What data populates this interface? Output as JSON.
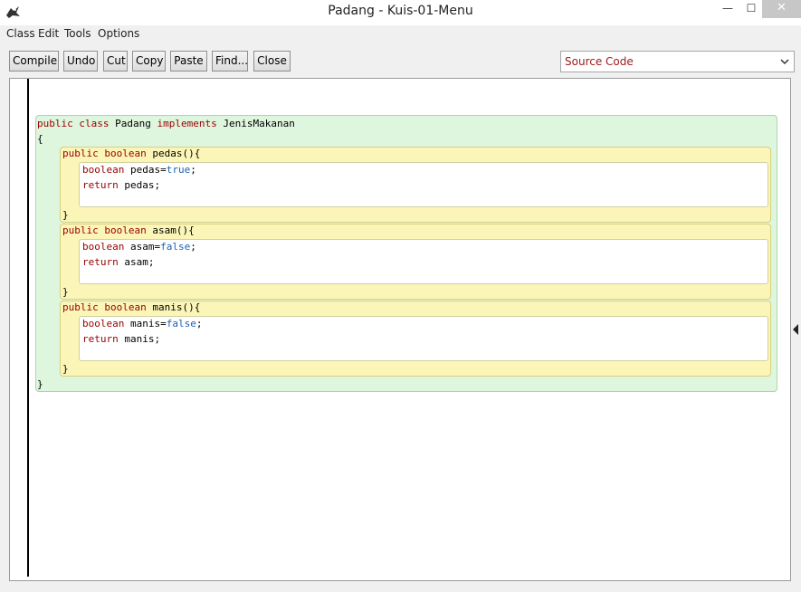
{
  "window": {
    "title": "Padang - Kuis-01-Menu",
    "min_glyph": "—",
    "max_glyph": "☐",
    "close_glyph": "✕"
  },
  "menu": [
    "Class",
    "Edit",
    "Tools",
    "Options"
  ],
  "toolbar": {
    "buttons": [
      "Compile",
      "Undo",
      "Cut",
      "Copy",
      "Paste",
      "Find...",
      "Close"
    ],
    "view_select": "Source Code"
  },
  "code": {
    "class_decl": {
      "kw1": "public",
      "kw2": "class",
      "name": "Padang",
      "kw3": "implements",
      "iface": "JenisMakanan"
    },
    "open_brace": "{",
    "close_brace": "}",
    "methods": [
      {
        "sig_kw1": "public",
        "sig_kw2": "boolean",
        "sig_name": "pedas(){",
        "line1_kw": "boolean",
        "line1_var": "pedas=",
        "line1_val": "true",
        "line1_end": ";",
        "line2_kw": "return",
        "line2_rest": "pedas;",
        "close": "}"
      },
      {
        "sig_kw1": "public",
        "sig_kw2": "boolean",
        "sig_name": "asam(){",
        "line1_kw": "boolean",
        "line1_var": "asam=",
        "line1_val": "false",
        "line1_end": ";",
        "line2_kw": "return",
        "line2_rest": "asam;",
        "close": "}"
      },
      {
        "sig_kw1": "public",
        "sig_kw2": "boolean",
        "sig_name": "manis(){",
        "line1_kw": "boolean",
        "line1_var": "manis=",
        "line1_val": "false",
        "line1_end": ";",
        "line2_kw": "return",
        "line2_rest": "manis;",
        "close": "}"
      }
    ]
  },
  "colors": {
    "keyword": "#990000",
    "literal": "#1a5fb4",
    "class_scope": "#def5de",
    "method_scope": "#fbf6b8"
  },
  "icons": {
    "app": "bluej-bird-icon",
    "select_arrow": "chevron-down-icon",
    "side_toggle": "triangle-left-icon"
  }
}
